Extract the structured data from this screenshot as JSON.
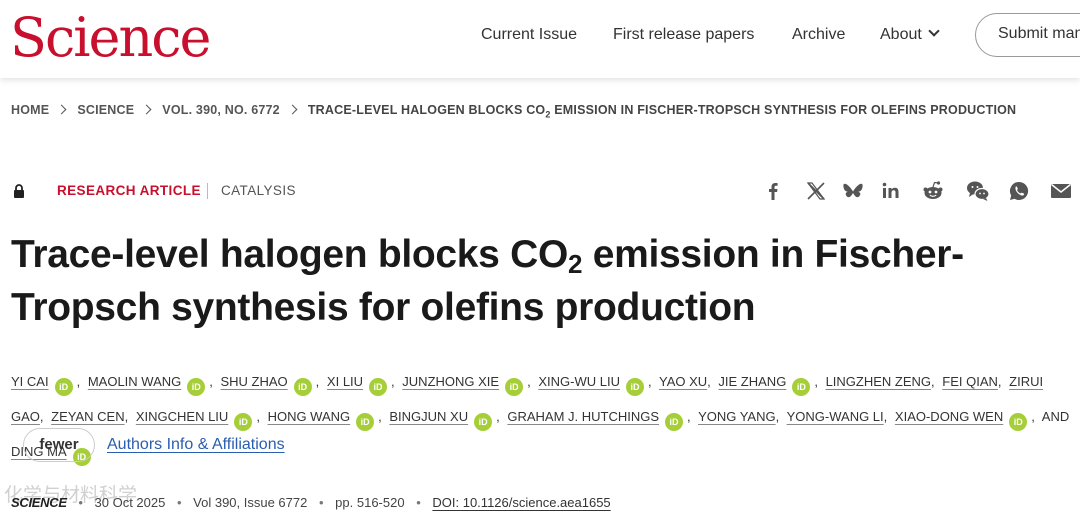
{
  "header": {
    "logo": "Science",
    "nav": [
      {
        "label": "Current Issue"
      },
      {
        "label": "First release papers"
      },
      {
        "label": "Archive"
      },
      {
        "label": "About"
      }
    ],
    "submit_label": "Submit manuscript"
  },
  "breadcrumb": {
    "items": [
      "HOME",
      "SCIENCE",
      "VOL. 390, NO. 6772"
    ],
    "current_pre": "TRACE-LEVEL HALOGEN BLOCKS CO",
    "current_sub": "2",
    "current_post": " EMISSION IN FISCHER-TROPSCH SYNTHESIS FOR OLEFINS PRODUCTION"
  },
  "article": {
    "type": "RESEARCH ARTICLE",
    "subject": "CATALYSIS",
    "title_pre": "Trace-level halogen blocks CO",
    "title_sub": "2",
    "title_post": " emission in Fischer-Tropsch synthesis for olefins production",
    "orcid_label": "iD",
    "authors": [
      {
        "name": "YI CAI",
        "orcid": true
      },
      {
        "name": "MAOLIN WANG",
        "orcid": true
      },
      {
        "name": "SHU ZHAO",
        "orcid": true
      },
      {
        "name": "XI LIU",
        "orcid": true
      },
      {
        "name": "JUNZHONG XIE",
        "orcid": true
      },
      {
        "name": "XING-WU LIU",
        "orcid": true
      },
      {
        "name": "YAO XU",
        "orcid": false
      },
      {
        "name": "JIE ZHANG",
        "orcid": true
      },
      {
        "name": "LINGZHEN ZENG",
        "orcid": false
      },
      {
        "name": "FEI QIAN",
        "orcid": false
      },
      {
        "name": "ZIRUI GAO",
        "orcid": false
      },
      {
        "name": "ZEYAN CEN",
        "orcid": false
      },
      {
        "name": "XINGCHEN LIU",
        "orcid": true
      },
      {
        "name": "HONG WANG",
        "orcid": true
      },
      {
        "name": "BINGJUN XU",
        "orcid": true
      },
      {
        "name": "GRAHAM J. HUTCHINGS",
        "orcid": true
      },
      {
        "name": "YONG YANG",
        "orcid": false
      },
      {
        "name": "YONG-WANG LI",
        "orcid": false
      },
      {
        "name": "XIAO-DONG WEN",
        "orcid": true
      },
      {
        "name": "DING MA",
        "orcid": true
      }
    ],
    "and_label": "AND",
    "fewer_label": "fewer",
    "affiliations_label": "Authors Info & Affiliations"
  },
  "citation": {
    "journal": "SCIENCE",
    "date": "30 Oct 2025",
    "volume": "Vol 390, Issue 6772",
    "pages": "pp. 516-520",
    "doi": "DOI: 10.1126/science.aea1655"
  },
  "watermark": "化学与材料科学",
  "colors": {
    "brand_red": "#c8102e",
    "orcid_green": "#a6ce39",
    "link_blue": "#2a5db0"
  },
  "share_icons": [
    "facebook-icon",
    "x-icon",
    "bluesky-icon",
    "linkedin-icon",
    "reddit-icon",
    "wechat-icon",
    "whatsapp-icon",
    "email-icon"
  ]
}
